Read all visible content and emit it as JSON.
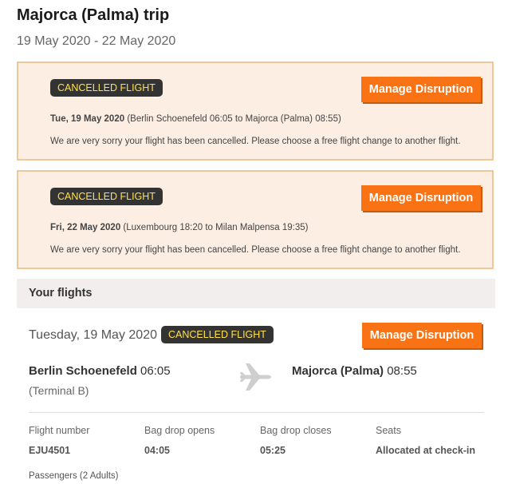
{
  "trip": {
    "title": "Majorca (Palma) trip",
    "dates": "19 May 2020 - 22 May 2020"
  },
  "alerts": [
    {
      "badge": "CANCELLED FLIGHT",
      "button": "Manage Disruption",
      "date": "Tue, 19 May 2020",
      "route": " (Berlin Schoenefeld 06:05 to Majorca (Palma) 08:55)",
      "message": "We are very sorry your flight has been cancelled. Please choose a free flight change to another flight."
    },
    {
      "badge": "CANCELLED FLIGHT",
      "button": "Manage Disruption",
      "date": "Fri, 22 May 2020",
      "route": " (Luxembourg 18:20 to Milan Malpensa 19:35)",
      "message": "We are very sorry your flight has been cancelled. Please choose a free flight change to another flight."
    }
  ],
  "your_flights": {
    "heading": "Your flights",
    "flight": {
      "date": "Tuesday, 19 May 2020",
      "badge": "CANCELLED FLIGHT",
      "button": "Manage Disruption",
      "origin_name": "Berlin Schoenefeld",
      "origin_time": " 06:05",
      "origin_terminal": "(Terminal B)",
      "dest_name": "Majorca (Palma)",
      "dest_time": " 08:55",
      "plane_icon": "plane-icon",
      "details": {
        "flight_number_label": "Flight number",
        "flight_number_value": "EJU4501",
        "bag_drop_opens_label": "Bag drop opens",
        "bag_drop_opens_value": "04:05",
        "bag_drop_closes_label": "Bag drop closes",
        "bag_drop_closes_value": "05:25",
        "seats_label": "Seats",
        "seats_value": "Allocated at check-in"
      },
      "passengers": "Passengers (2 Adults)"
    }
  },
  "colors": {
    "accent": "#f97315",
    "badge_bg": "#333333",
    "badge_text": "#ffe14d",
    "alert_bg": "#fdeee4",
    "alert_border": "#f0c99a"
  }
}
